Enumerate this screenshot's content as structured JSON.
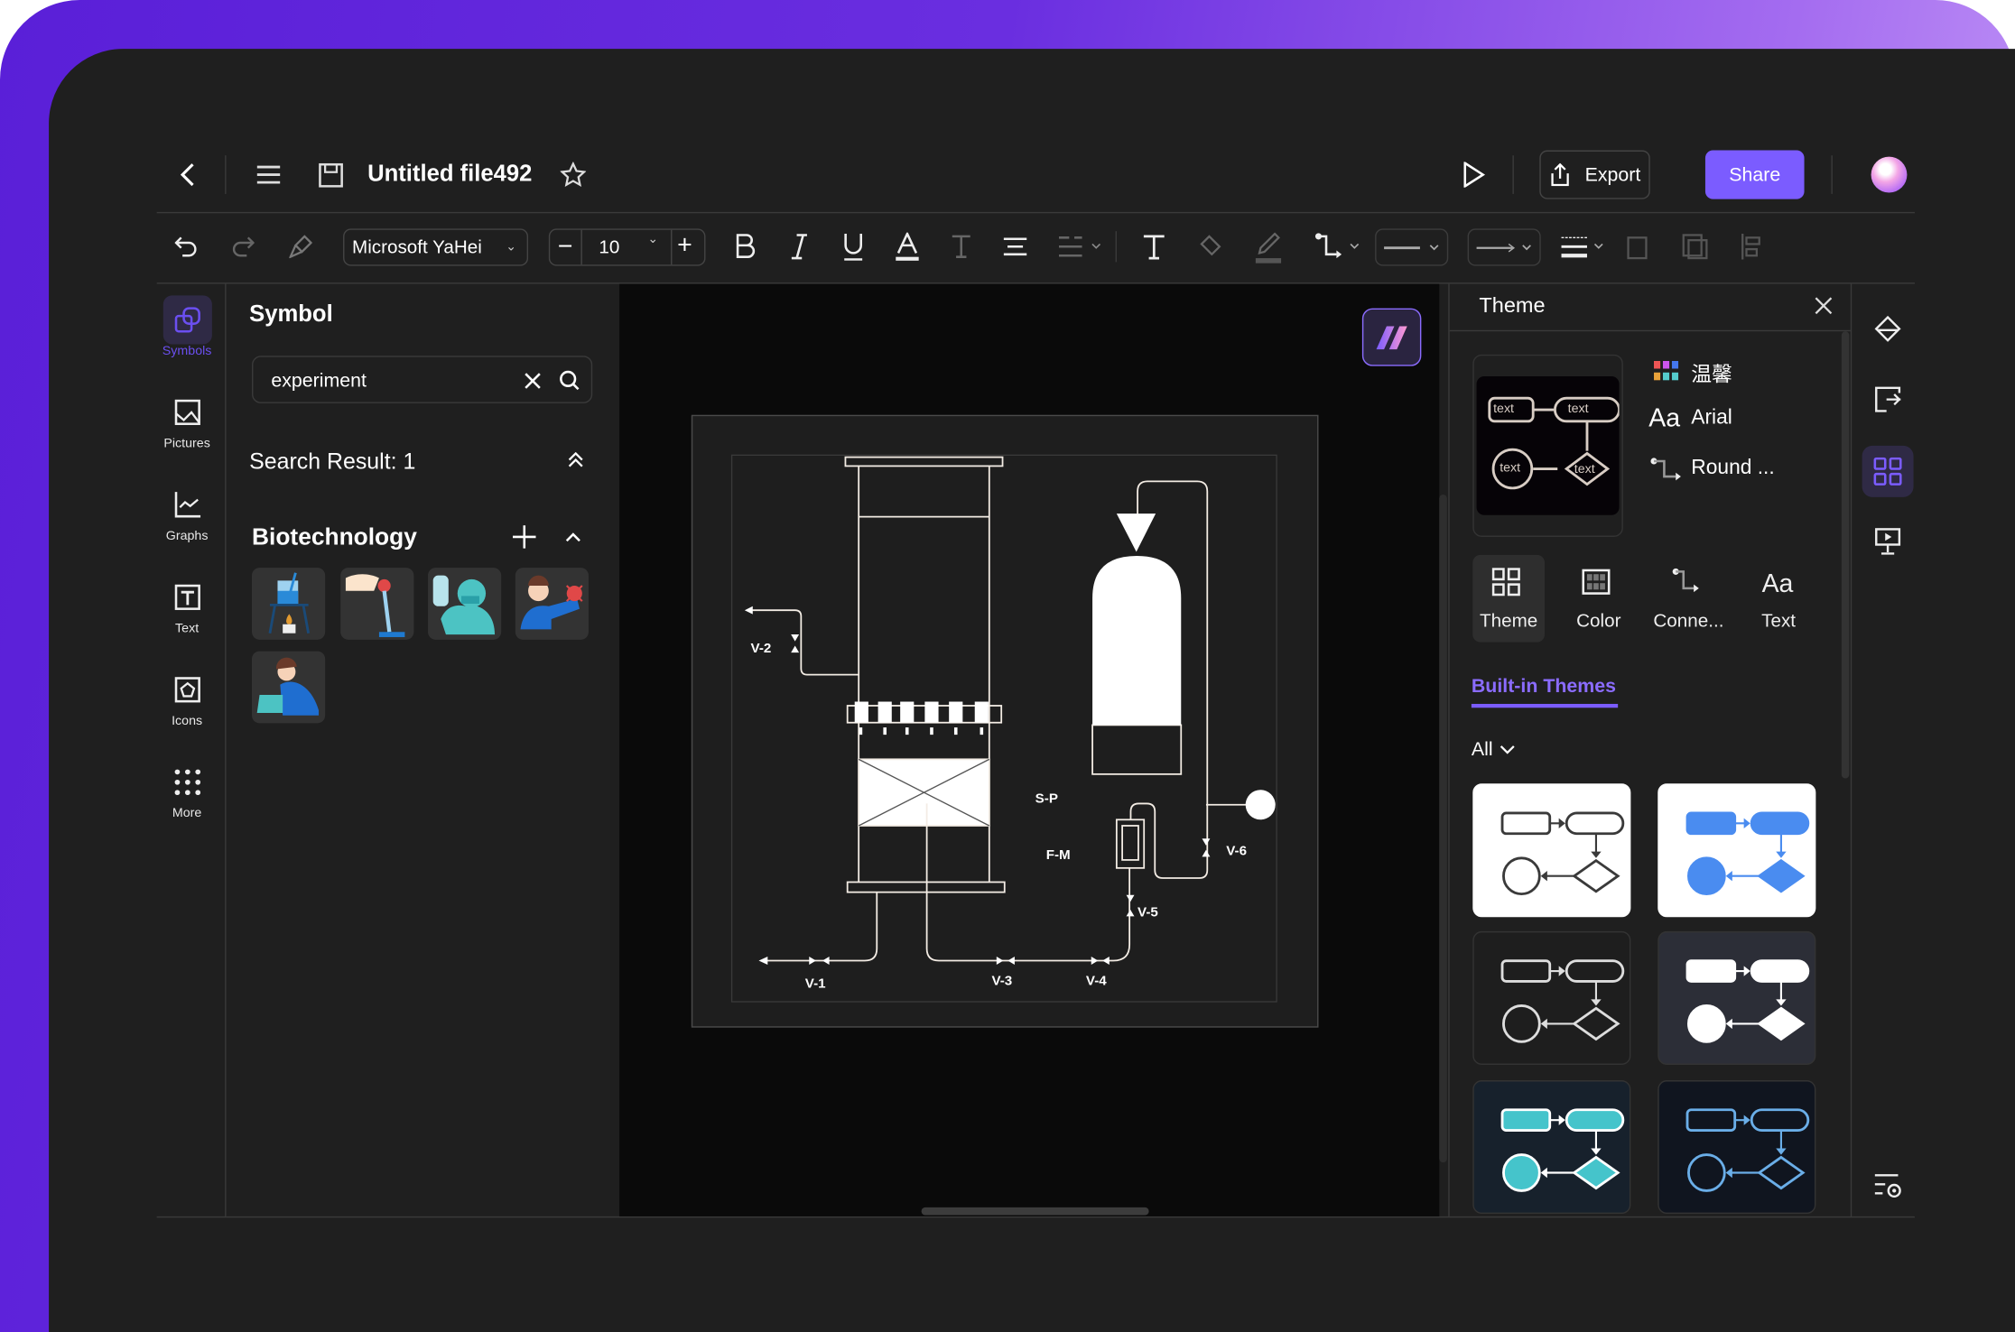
{
  "header": {
    "title": "Untitled file492",
    "export_label": "Export",
    "share_label": "Share"
  },
  "toolbar": {
    "font": "Microsoft YaHei",
    "font_size": "10"
  },
  "left_rail": [
    {
      "label": "Symbols",
      "icon": "symbols-icon",
      "active": true
    },
    {
      "label": "Pictures",
      "icon": "pictures-icon"
    },
    {
      "label": "Graphs",
      "icon": "graphs-icon"
    },
    {
      "label": "Text",
      "icon": "text-icon"
    },
    {
      "label": "Icons",
      "icon": "icons-icon"
    },
    {
      "label": "More",
      "icon": "more-icon"
    }
  ],
  "symbol_panel": {
    "title": "Symbol",
    "search_value": "experiment",
    "search_result": "Search Result: 1",
    "category": "Biotechnology",
    "thumbnails": [
      "beaker-burner",
      "pipette",
      "scientist-flask",
      "scientist-virus",
      "scientist-microscope"
    ]
  },
  "diagram": {
    "labels": {
      "v1": "V-1",
      "v2": "V-2",
      "v3": "V-3",
      "v4": "V-4",
      "v5": "V-5",
      "v6": "V-6",
      "sp": "S-P",
      "fm": "F-M"
    }
  },
  "theme_panel": {
    "title": "Theme",
    "preview_text": "text",
    "color_scheme": "温馨",
    "font": "Arial",
    "connector": "Round ...",
    "tabs": [
      {
        "label": "Theme",
        "active": true
      },
      {
        "label": "Color"
      },
      {
        "label": "Conne..."
      },
      {
        "label": "Text"
      }
    ],
    "built_in_label": "Built-in Themes",
    "filter": "All",
    "themes": [
      {
        "bg": "#ffffff",
        "stroke": "#3a3a3a",
        "fill": "none"
      },
      {
        "bg": "#ffffff",
        "stroke": "#4a8cf0",
        "fill": "#4a8cf0"
      },
      {
        "bg": "#1e1e1e",
        "stroke": "#dddddd",
        "fill": "none"
      },
      {
        "bg": "#2c2e37",
        "stroke": "#ffffff",
        "fill": "#ffffff"
      },
      {
        "bg": "#17212c",
        "stroke": "#ffffff",
        "fill": "#45c4cb"
      },
      {
        "bg": "#10151f",
        "stroke": "#6aaee8",
        "fill": "none"
      }
    ]
  },
  "colors": {
    "accent": "#7b5cff",
    "window": "#1f1f1f",
    "canvas": "#0a0a0a"
  }
}
